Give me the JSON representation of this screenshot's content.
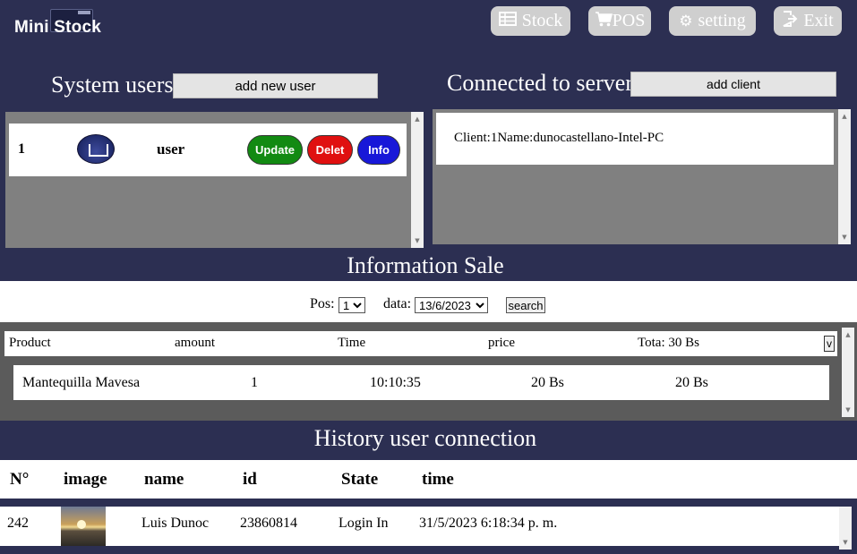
{
  "app": {
    "logo_text": "Mini Stock"
  },
  "nav": {
    "stock": {
      "label": "Stock",
      "icon": "table-icon"
    },
    "pos": {
      "label": "POS",
      "icon": "cart-icon"
    },
    "setting": {
      "label": "setting",
      "icon": "gears-icon"
    },
    "exit": {
      "label": "Exit",
      "icon": "exit-icon"
    }
  },
  "users": {
    "title": "System users",
    "add_label": "add new user",
    "rows": [
      {
        "num": "1",
        "name": "user",
        "update": "Update",
        "delete": "Delet",
        "info": "Info"
      }
    ]
  },
  "server": {
    "title": "Connected to server",
    "add_label": "add client",
    "clients": [
      "Client:1Name:dunocastellano-Intel-PC"
    ]
  },
  "sale": {
    "title": "Information Sale",
    "pos_label": "Pos:",
    "pos_value": "1",
    "date_label": "data:",
    "date_value": "13/6/2023",
    "search_label": "search",
    "headers": {
      "product": "Product",
      "amount": "amount",
      "time": "Time",
      "price": "price",
      "total": "Tota: 30 Bs",
      "toggle": "v"
    },
    "rows": [
      {
        "product": "Mantequilla Mavesa",
        "amount": "1",
        "time": "10:10:35",
        "price": "20 Bs",
        "subtotal": "20 Bs"
      }
    ]
  },
  "history": {
    "title": "History user connection",
    "headers": {
      "num": "N°",
      "image": "image",
      "name": "name",
      "id": "id",
      "state": "State",
      "time": "time"
    },
    "rows": [
      {
        "num": "242",
        "name": "Luis Dunoc",
        "id": "23860814",
        "state": "Login In",
        "time": "31/5/2023 6:18:34 p. m."
      }
    ]
  },
  "colors": {
    "background": "#2c2f52",
    "button_gray": "#cfcfcf",
    "update": "#128a12",
    "delete": "#e01010",
    "info": "#1818d8"
  }
}
